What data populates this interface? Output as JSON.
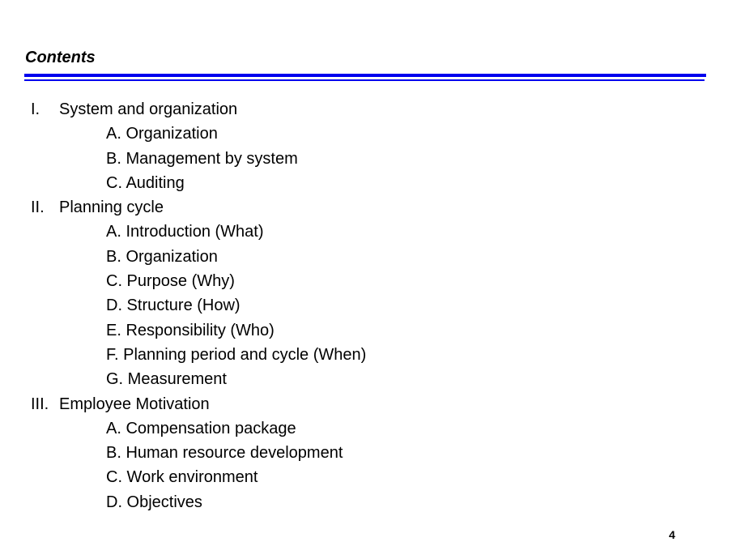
{
  "title": "Contents",
  "colors": {
    "rule": "#0000ee"
  },
  "sections": [
    {
      "numeral": "I.",
      "label": "System and organization",
      "items": [
        "A. Organization",
        "B. Management by system",
        "C. Auditing"
      ]
    },
    {
      "numeral": "II.",
      "label": "Planning cycle",
      "items": [
        "A. Introduction (What)",
        "B. Organization",
        "C. Purpose (Why)",
        "D. Structure (How)",
        "E. Responsibility (Who)",
        "F. Planning period and cycle (When)",
        "G. Measurement"
      ]
    },
    {
      "numeral": "III.",
      "label": "Employee Motivation",
      "items": [
        "A. Compensation package",
        "B. Human resource development",
        "C. Work environment",
        "D. Objectives"
      ]
    }
  ],
  "page_number": "4"
}
